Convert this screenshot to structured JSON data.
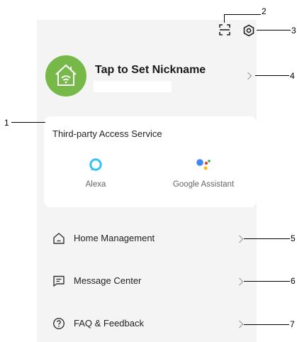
{
  "profile": {
    "nickname": "Tap to Set Nickname"
  },
  "third_party": {
    "title": "Third-party Access Service",
    "services": [
      {
        "label": "Alexa",
        "icon": "alexa-icon",
        "color": "#31c4f3"
      },
      {
        "label": "Google Assistant",
        "icon": "google-assistant-icon"
      }
    ]
  },
  "menu": [
    {
      "label": "Home Management",
      "icon": "home-icon"
    },
    {
      "label": "Message Center",
      "icon": "message-icon"
    },
    {
      "label": "FAQ & Feedback",
      "icon": "help-icon"
    }
  ],
  "callouts": [
    "1",
    "2",
    "3",
    "4",
    "5",
    "6",
    "7"
  ],
  "colors": {
    "avatar": "#77b948",
    "background": "#f4f4f4",
    "card": "#ffffff",
    "google_blue": "#4285f4",
    "google_red": "#ea4335",
    "google_yellow": "#fbbc05",
    "google_green": "#34a853"
  }
}
